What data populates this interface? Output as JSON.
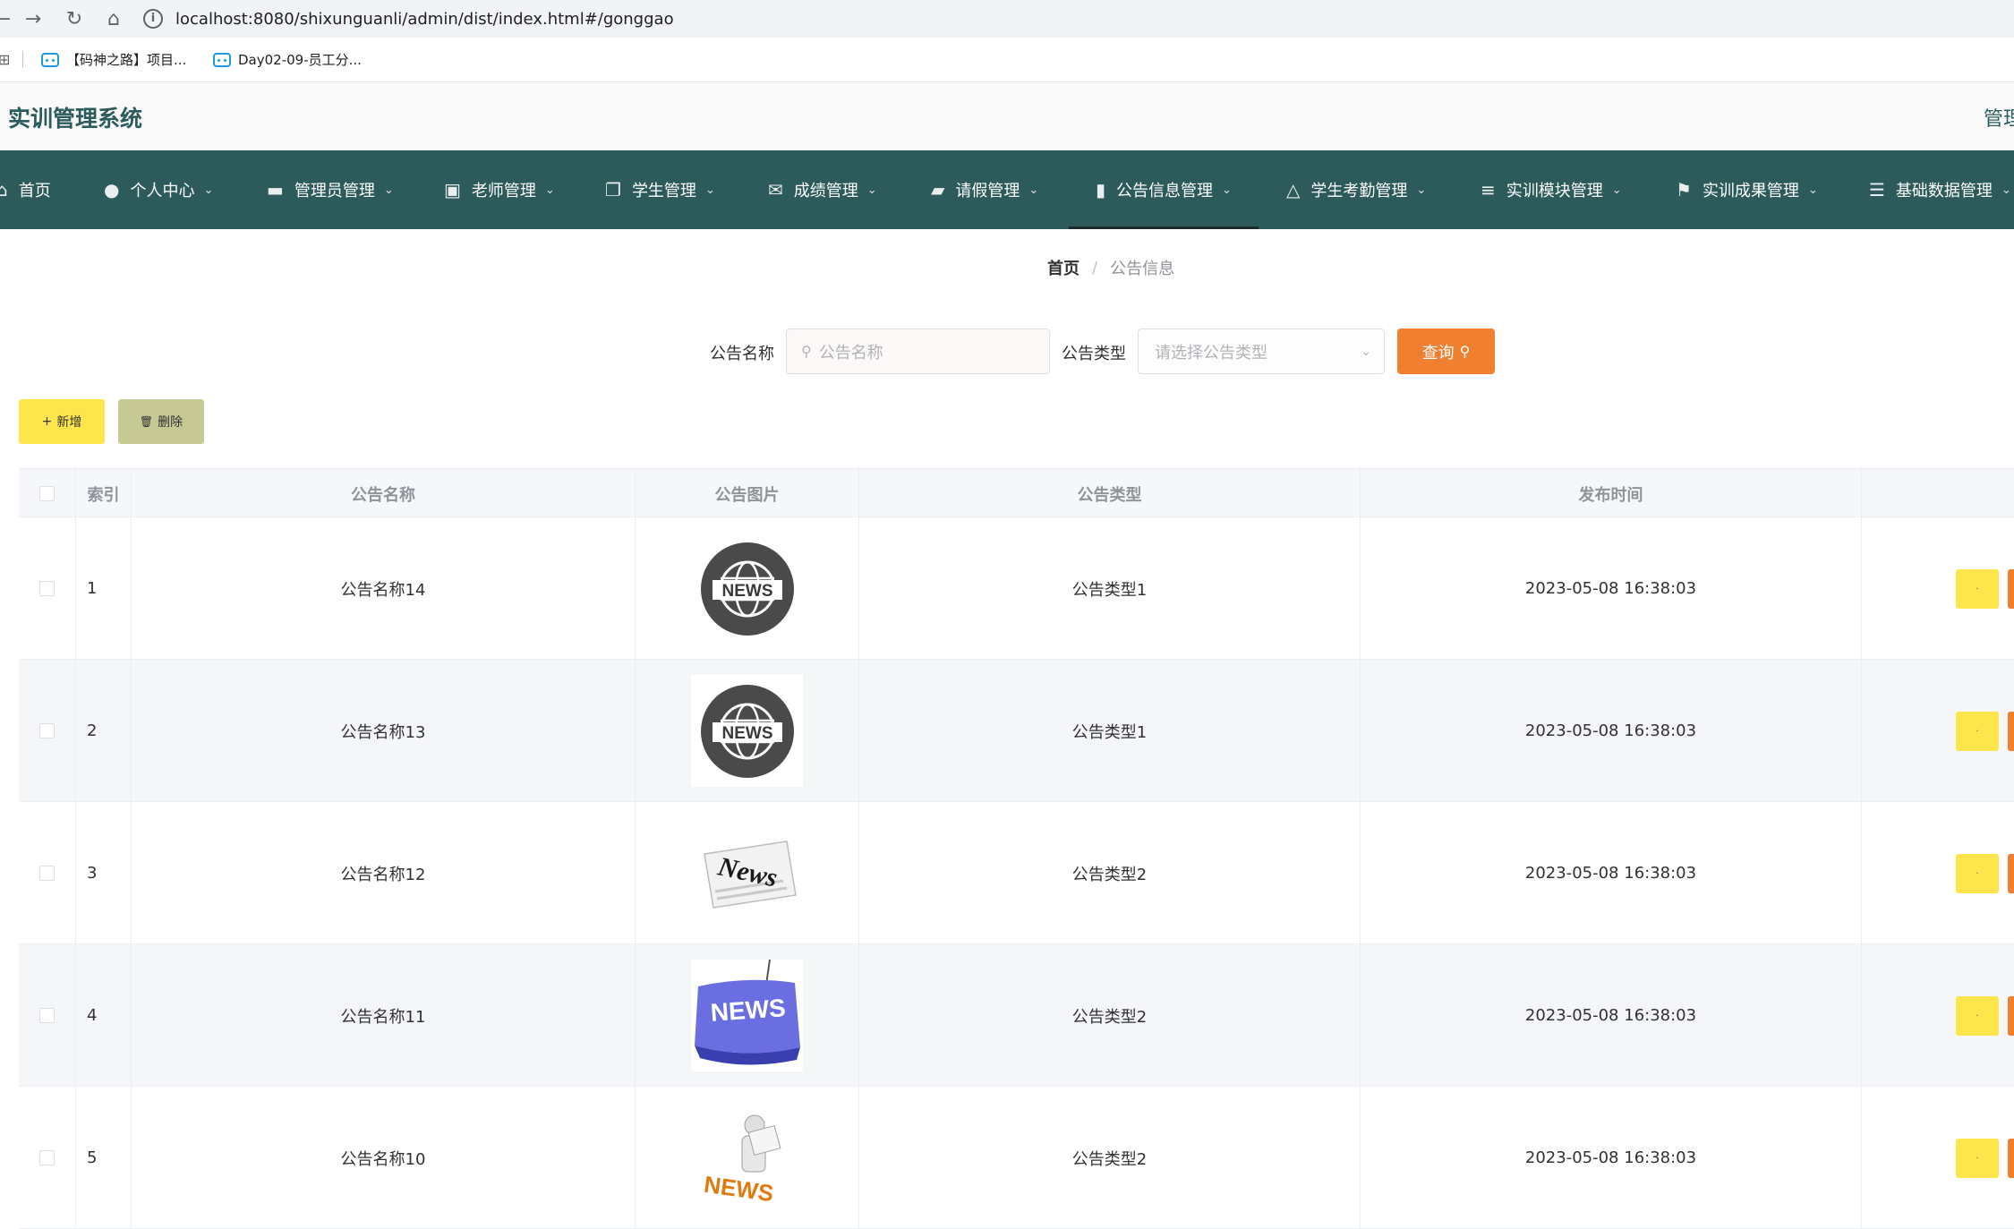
{
  "browser": {
    "url": "localhost:8080/shixunguanli/admin/dist/index.html#/gonggao",
    "bookmarks": [
      "【码神之路】项目...",
      "Day02-09-员工分..."
    ]
  },
  "header": {
    "title": "实训管理系统",
    "right_text": "管理"
  },
  "menu": {
    "items": [
      {
        "label": "首页",
        "icon": "home-icon"
      },
      {
        "label": "个人中心",
        "icon": "user-icon"
      },
      {
        "label": "管理员管理",
        "icon": "briefcase-icon"
      },
      {
        "label": "老师管理",
        "icon": "clipboard-icon"
      },
      {
        "label": "学生管理",
        "icon": "copy-icon"
      },
      {
        "label": "成绩管理",
        "icon": "ticket-icon"
      },
      {
        "label": "请假管理",
        "icon": "wallet-icon"
      },
      {
        "label": "公告信息管理",
        "icon": "microphone-icon"
      },
      {
        "label": "学生考勤管理",
        "icon": "bell-off-icon"
      },
      {
        "label": "实训模块管理",
        "icon": "list-icon"
      },
      {
        "label": "实训成果管理",
        "icon": "flag-icon"
      },
      {
        "label": "基础数据管理",
        "icon": "sliders-icon"
      }
    ],
    "active": "公告信息管理"
  },
  "breadcrumb": {
    "home": "首页",
    "separator": "/",
    "current": "公告信息"
  },
  "search": {
    "name_label": "公告名称",
    "name_placeholder": "公告名称",
    "type_label": "公告类型",
    "type_placeholder": "请选择公告类型",
    "query_label": "查询"
  },
  "actions": {
    "add_label": "新增",
    "delete_label": "删除"
  },
  "table": {
    "columns": [
      "索引",
      "公告名称",
      "公告图片",
      "公告类型",
      "发布时间"
    ],
    "rows": [
      {
        "index": "1",
        "name": "公告名称14",
        "image": "news-globe-dark",
        "type": "公告类型1",
        "time": "2023-05-08 16:38:03"
      },
      {
        "index": "2",
        "name": "公告名称13",
        "image": "news-globe-dark",
        "type": "公告类型1",
        "time": "2023-05-08 16:38:03"
      },
      {
        "index": "3",
        "name": "公告名称12",
        "image": "news-newspaper",
        "type": "公告类型2",
        "time": "2023-05-08 16:38:03"
      },
      {
        "index": "4",
        "name": "公告名称11",
        "image": "news-blue-key",
        "type": "公告类型2",
        "time": "2023-05-08 16:38:03"
      },
      {
        "index": "5",
        "name": "公告名称10",
        "image": "news-figure",
        "type": "公告类型2",
        "time": "2023-05-08 16:38:03"
      }
    ],
    "op_label": "·"
  },
  "colors": {
    "menu_bg": "#2d5b5b",
    "accent_orange": "#f08030",
    "accent_yellow": "#fde64b",
    "delete_olive": "#c6c994"
  }
}
